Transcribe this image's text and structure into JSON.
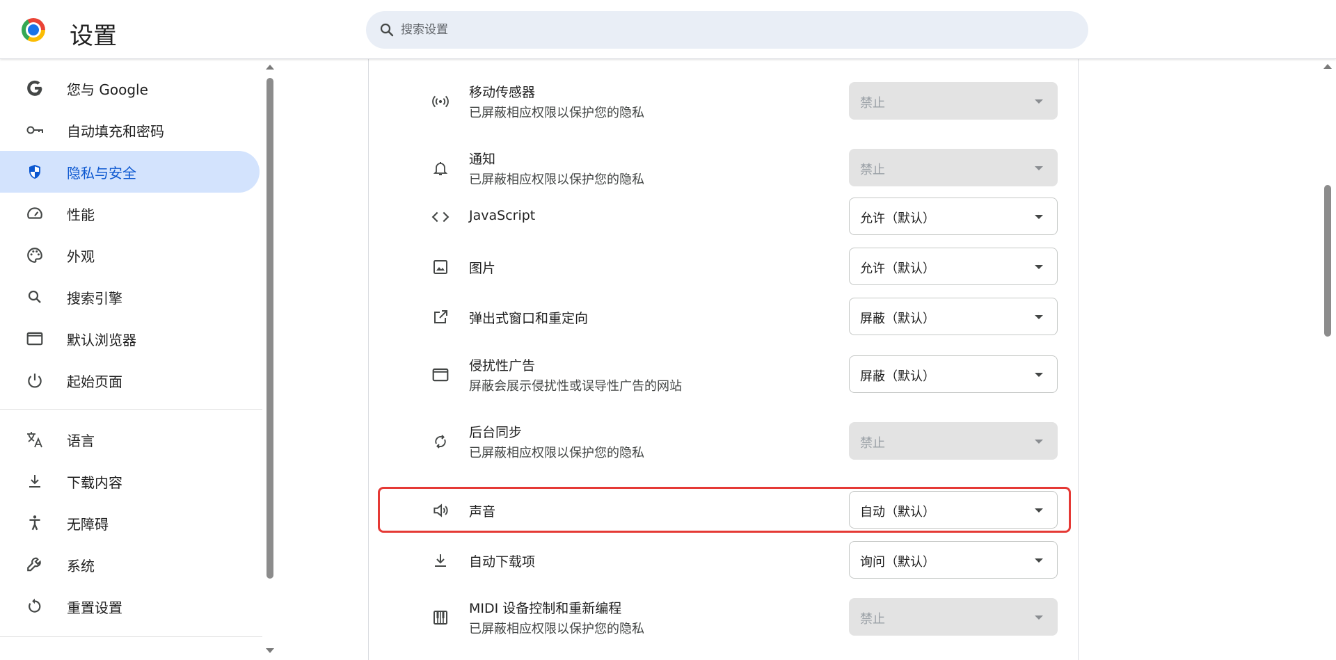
{
  "header": {
    "title": "设置",
    "search_placeholder": "搜索设置"
  },
  "sidebar": {
    "items": [
      {
        "label": "您与 Google",
        "icon": "google-icon"
      },
      {
        "label": "自动填充和密码",
        "icon": "key-icon"
      },
      {
        "label": "隐私与安全",
        "icon": "shield-icon",
        "active": true
      },
      {
        "label": "性能",
        "icon": "speedometer-icon"
      },
      {
        "label": "外观",
        "icon": "palette-icon"
      },
      {
        "label": "搜索引擎",
        "icon": "search-icon"
      },
      {
        "label": "默认浏览器",
        "icon": "browser-window-icon"
      },
      {
        "label": "起始页面",
        "icon": "power-icon"
      },
      {
        "label": "语言",
        "icon": "translate-icon"
      },
      {
        "label": "下载内容",
        "icon": "download-icon"
      },
      {
        "label": "无障碍",
        "icon": "accessibility-icon"
      },
      {
        "label": "系统",
        "icon": "wrench-icon"
      },
      {
        "label": "重置设置",
        "icon": "reset-icon"
      }
    ]
  },
  "permissions": [
    {
      "title": "移动传感器",
      "subtitle": "已屏蔽相应权限以保护您的隐私",
      "value": "禁止",
      "disabled": true,
      "icon": "sensors-icon"
    },
    {
      "title": "通知",
      "subtitle": "已屏蔽相应权限以保护您的隐私",
      "value": "禁止",
      "disabled": true,
      "icon": "bell-icon"
    },
    {
      "title": "JavaScript",
      "value": "允许（默认）",
      "icon": "code-icon"
    },
    {
      "title": "图片",
      "value": "允许（默认）",
      "icon": "image-icon"
    },
    {
      "title": "弹出式窗口和重定向",
      "value": "屏蔽（默认）",
      "icon": "open-in-new-icon"
    },
    {
      "title": "侵扰性广告",
      "subtitle": "屏蔽会展示侵扰性或误导性广告的网站",
      "value": "屏蔽（默认）",
      "icon": "ad-window-icon"
    },
    {
      "title": "后台同步",
      "subtitle": "已屏蔽相应权限以保护您的隐私",
      "value": "禁止",
      "disabled": true,
      "icon": "sync-icon"
    },
    {
      "title": "声音",
      "value": "自动（默认）",
      "icon": "volume-icon",
      "highlighted": true
    },
    {
      "title": "自动下载项",
      "value": "询问（默认）",
      "icon": "download-icon"
    },
    {
      "title": "MIDI 设备控制和重新编程",
      "subtitle": "已屏蔽相应权限以保护您的隐私",
      "value": "禁止",
      "disabled": true,
      "icon": "piano-icon"
    }
  ],
  "colors": {
    "accent": "#0b57d0",
    "active_bg": "#d3e3fd",
    "highlight_border": "#e53935",
    "disabled_bg": "#e3e3e3"
  }
}
